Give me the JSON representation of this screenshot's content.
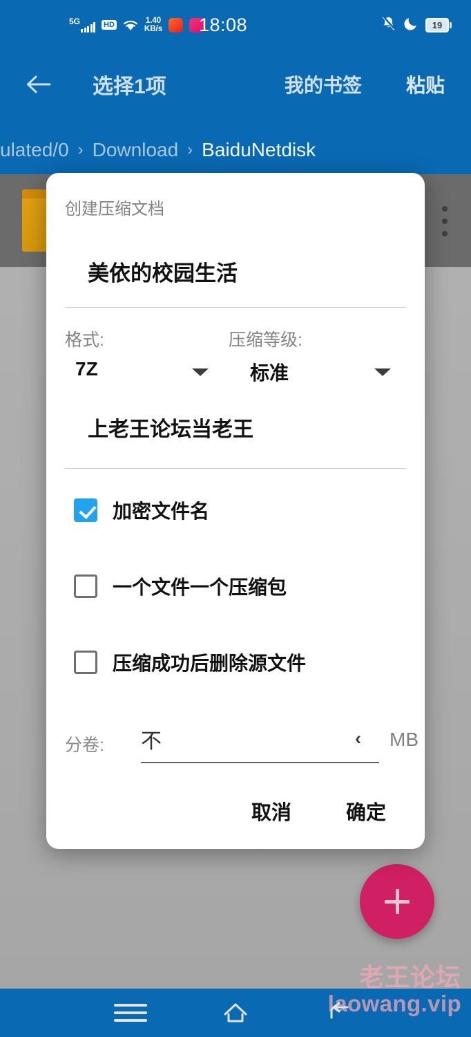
{
  "colors": {
    "header_blue": "#0969b2",
    "accent_checkbox": "#21a3ef",
    "fab_pink": "#d11f63",
    "folder_yellow": "#e09a0d",
    "watermark_pink": "#f0a8b8"
  },
  "status_bar": {
    "network_type": "5G",
    "hd_badge": "HD",
    "wifi_icon": "wifi-icon",
    "net_speed_value": "1.40",
    "net_speed_unit": "KB/s",
    "app_icon_1": "app-icon-recorder",
    "app_icon_2": "app-icon-music",
    "clock": "18:08",
    "dnd_icon": "bell-muted-icon",
    "moon_icon": "moon-icon",
    "battery_level": "19"
  },
  "app_bar": {
    "back_icon": "back-arrow-icon",
    "title": "选择1项",
    "action_bookmark": "我的书签",
    "action_paste": "粘贴"
  },
  "breadcrumb": {
    "separator": "›",
    "items": [
      {
        "label": "ulated/0",
        "current": false
      },
      {
        "label": "Download",
        "current": false
      },
      {
        "label": "BaiduNetdisk",
        "current": true
      }
    ]
  },
  "file_list": {
    "row_folder_icon": "folder-icon",
    "row_overflow_icon": "more-vertical-icon"
  },
  "fab": {
    "icon": "plus-icon"
  },
  "watermark": {
    "line1": "老王论坛",
    "line2": "laowang.vip"
  },
  "nav_bar": {
    "recents_icon": "menu-icon",
    "home_icon": "home-icon",
    "back_icon": "back-icon"
  },
  "dialog": {
    "title": "创建压缩文档",
    "archive_name": "美依的校园生活",
    "format_label": "格式:",
    "format_value": "7Z",
    "format_arrow_icon": "chevron-down-icon",
    "level_label": "压缩等级:",
    "level_value": "标准",
    "level_arrow_icon": "chevron-down-icon",
    "password_value": "上老王论坛当老王",
    "checkboxes": [
      {
        "label": "加密文件名",
        "checked": true
      },
      {
        "label": "一个文件一个压缩包",
        "checked": false
      },
      {
        "label": "压缩成功后删除源文件",
        "checked": false
      }
    ],
    "split_label": "分卷:",
    "split_value": "不",
    "split_chevron": "‹",
    "split_unit": "MB",
    "button_cancel": "取消",
    "button_ok": "确定"
  }
}
